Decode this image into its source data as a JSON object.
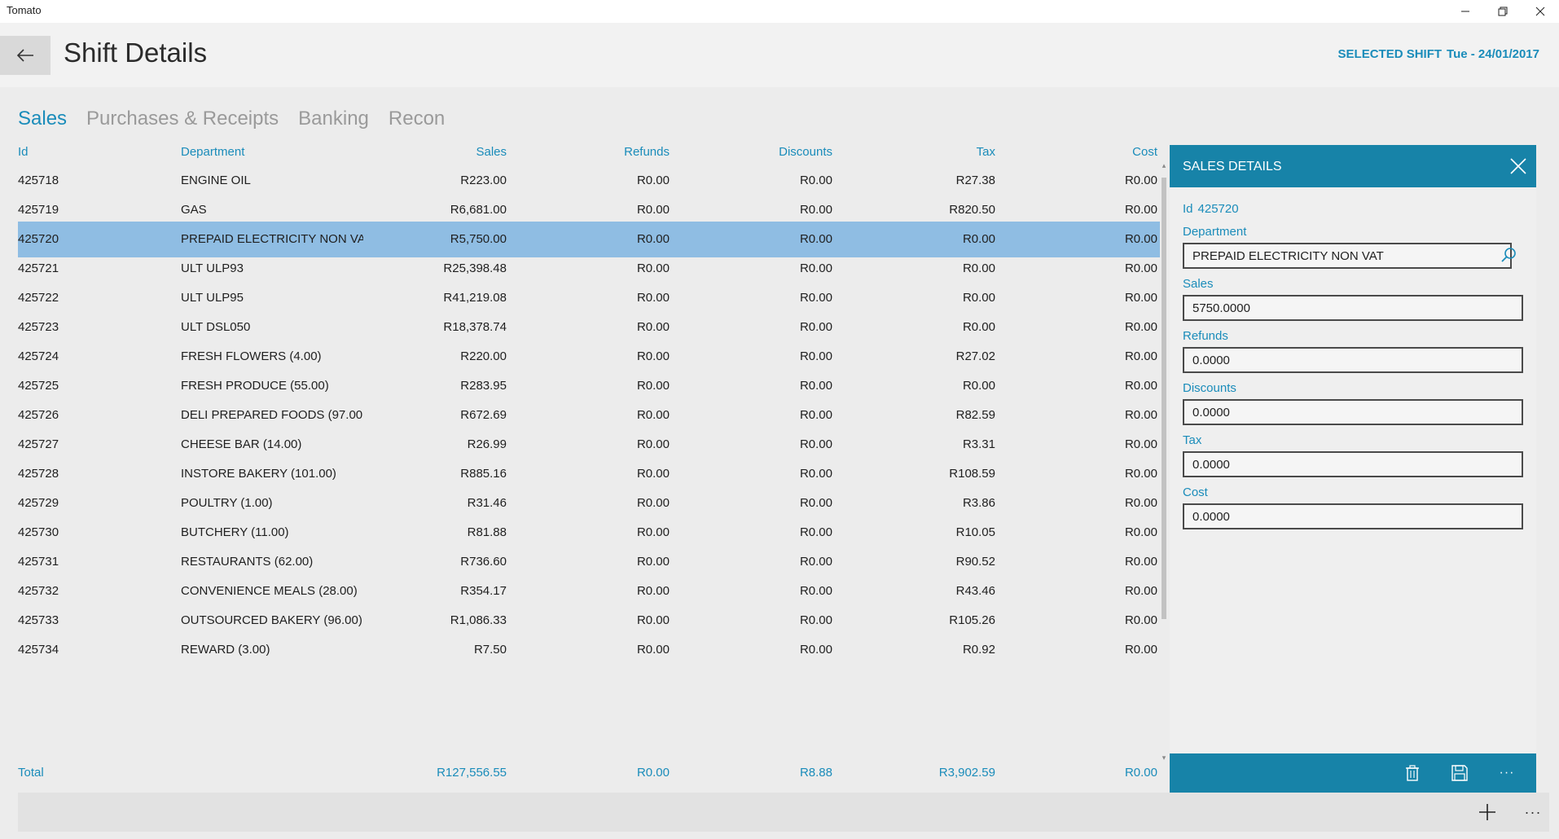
{
  "window": {
    "title": "Tomato"
  },
  "header": {
    "title": "Shift Details",
    "selected_shift_label": "SELECTED SHIFT",
    "selected_shift_value": "Tue - 24/01/2017"
  },
  "tabs": [
    "Sales",
    "Purchases & Receipts",
    "Banking",
    "Recon"
  ],
  "active_tab": "Sales",
  "table": {
    "columns": [
      "Id",
      "Department",
      "Sales",
      "Refunds",
      "Discounts",
      "Tax",
      "Cost"
    ],
    "selected_id": "425720",
    "rows": [
      {
        "id": "425718",
        "department": "ENGINE OIL",
        "sales": "R223.00",
        "refunds": "R0.00",
        "discounts": "R0.00",
        "tax": "R27.38",
        "cost": "R0.00"
      },
      {
        "id": "425719",
        "department": "GAS",
        "sales": "R6,681.00",
        "refunds": "R0.00",
        "discounts": "R0.00",
        "tax": "R820.50",
        "cost": "R0.00"
      },
      {
        "id": "425720",
        "department": "PREPAID ELECTRICITY NON VA",
        "sales": "R5,750.00",
        "refunds": "R0.00",
        "discounts": "R0.00",
        "tax": "R0.00",
        "cost": "R0.00"
      },
      {
        "id": "425721",
        "department": "ULT ULP93",
        "sales": "R25,398.48",
        "refunds": "R0.00",
        "discounts": "R0.00",
        "tax": "R0.00",
        "cost": "R0.00"
      },
      {
        "id": "425722",
        "department": "ULT ULP95",
        "sales": "R41,219.08",
        "refunds": "R0.00",
        "discounts": "R0.00",
        "tax": "R0.00",
        "cost": "R0.00"
      },
      {
        "id": "425723",
        "department": "ULT DSL050",
        "sales": "R18,378.74",
        "refunds": "R0.00",
        "discounts": "R0.00",
        "tax": "R0.00",
        "cost": "R0.00"
      },
      {
        "id": "425724",
        "department": "FRESH FLOWERS (4.00)",
        "sales": "R220.00",
        "refunds": "R0.00",
        "discounts": "R0.00",
        "tax": "R27.02",
        "cost": "R0.00"
      },
      {
        "id": "425725",
        "department": "FRESH PRODUCE (55.00)",
        "sales": "R283.95",
        "refunds": "R0.00",
        "discounts": "R0.00",
        "tax": "R0.00",
        "cost": "R0.00"
      },
      {
        "id": "425726",
        "department": "DELI PREPARED FOODS (97.00",
        "sales": "R672.69",
        "refunds": "R0.00",
        "discounts": "R0.00",
        "tax": "R82.59",
        "cost": "R0.00"
      },
      {
        "id": "425727",
        "department": "CHEESE BAR (14.00)",
        "sales": "R26.99",
        "refunds": "R0.00",
        "discounts": "R0.00",
        "tax": "R3.31",
        "cost": "R0.00"
      },
      {
        "id": "425728",
        "department": "INSTORE BAKERY (101.00)",
        "sales": "R885.16",
        "refunds": "R0.00",
        "discounts": "R0.00",
        "tax": "R108.59",
        "cost": "R0.00"
      },
      {
        "id": "425729",
        "department": "POULTRY (1.00)",
        "sales": "R31.46",
        "refunds": "R0.00",
        "discounts": "R0.00",
        "tax": "R3.86",
        "cost": "R0.00"
      },
      {
        "id": "425730",
        "department": "BUTCHERY (11.00)",
        "sales": "R81.88",
        "refunds": "R0.00",
        "discounts": "R0.00",
        "tax": "R10.05",
        "cost": "R0.00"
      },
      {
        "id": "425731",
        "department": "RESTAURANTS (62.00)",
        "sales": "R736.60",
        "refunds": "R0.00",
        "discounts": "R0.00",
        "tax": "R90.52",
        "cost": "R0.00"
      },
      {
        "id": "425732",
        "department": "CONVENIENCE MEALS (28.00)",
        "sales": "R354.17",
        "refunds": "R0.00",
        "discounts": "R0.00",
        "tax": "R43.46",
        "cost": "R0.00"
      },
      {
        "id": "425733",
        "department": "OUTSOURCED BAKERY (96.00)",
        "sales": "R1,086.33",
        "refunds": "R0.00",
        "discounts": "R0.00",
        "tax": "R105.26",
        "cost": "R0.00"
      },
      {
        "id": "425734",
        "department": "REWARD (3.00)",
        "sales": "R7.50",
        "refunds": "R0.00",
        "discounts": "R0.00",
        "tax": "R0.92",
        "cost": "R0.00"
      }
    ],
    "totals": {
      "label": "Total",
      "sales": "R127,556.55",
      "refunds": "R0.00",
      "discounts": "R8.88",
      "tax": "R3,902.59",
      "cost": "R0.00"
    }
  },
  "panel": {
    "title": "SALES DETAILS",
    "id_label": "Id",
    "id_value": "425720",
    "fields": [
      {
        "label": "Department",
        "value": "PREPAID ELECTRICITY NON VAT"
      },
      {
        "label": "Sales",
        "value": "5750.0000"
      },
      {
        "label": "Refunds",
        "value": "0.0000"
      },
      {
        "label": "Discounts",
        "value": "0.0000"
      },
      {
        "label": "Tax",
        "value": "0.0000"
      },
      {
        "label": "Cost",
        "value": "0.0000"
      }
    ],
    "footer_actions": [
      "delete-icon",
      "save-icon",
      "more-icon"
    ]
  },
  "bottom_bar": {
    "actions": [
      "add-icon",
      "more-icon"
    ],
    "more_label": "···"
  },
  "colors": {
    "accent": "#1a8cba",
    "panel_header": "#1783a8",
    "selected_row": "#8fbde3"
  }
}
